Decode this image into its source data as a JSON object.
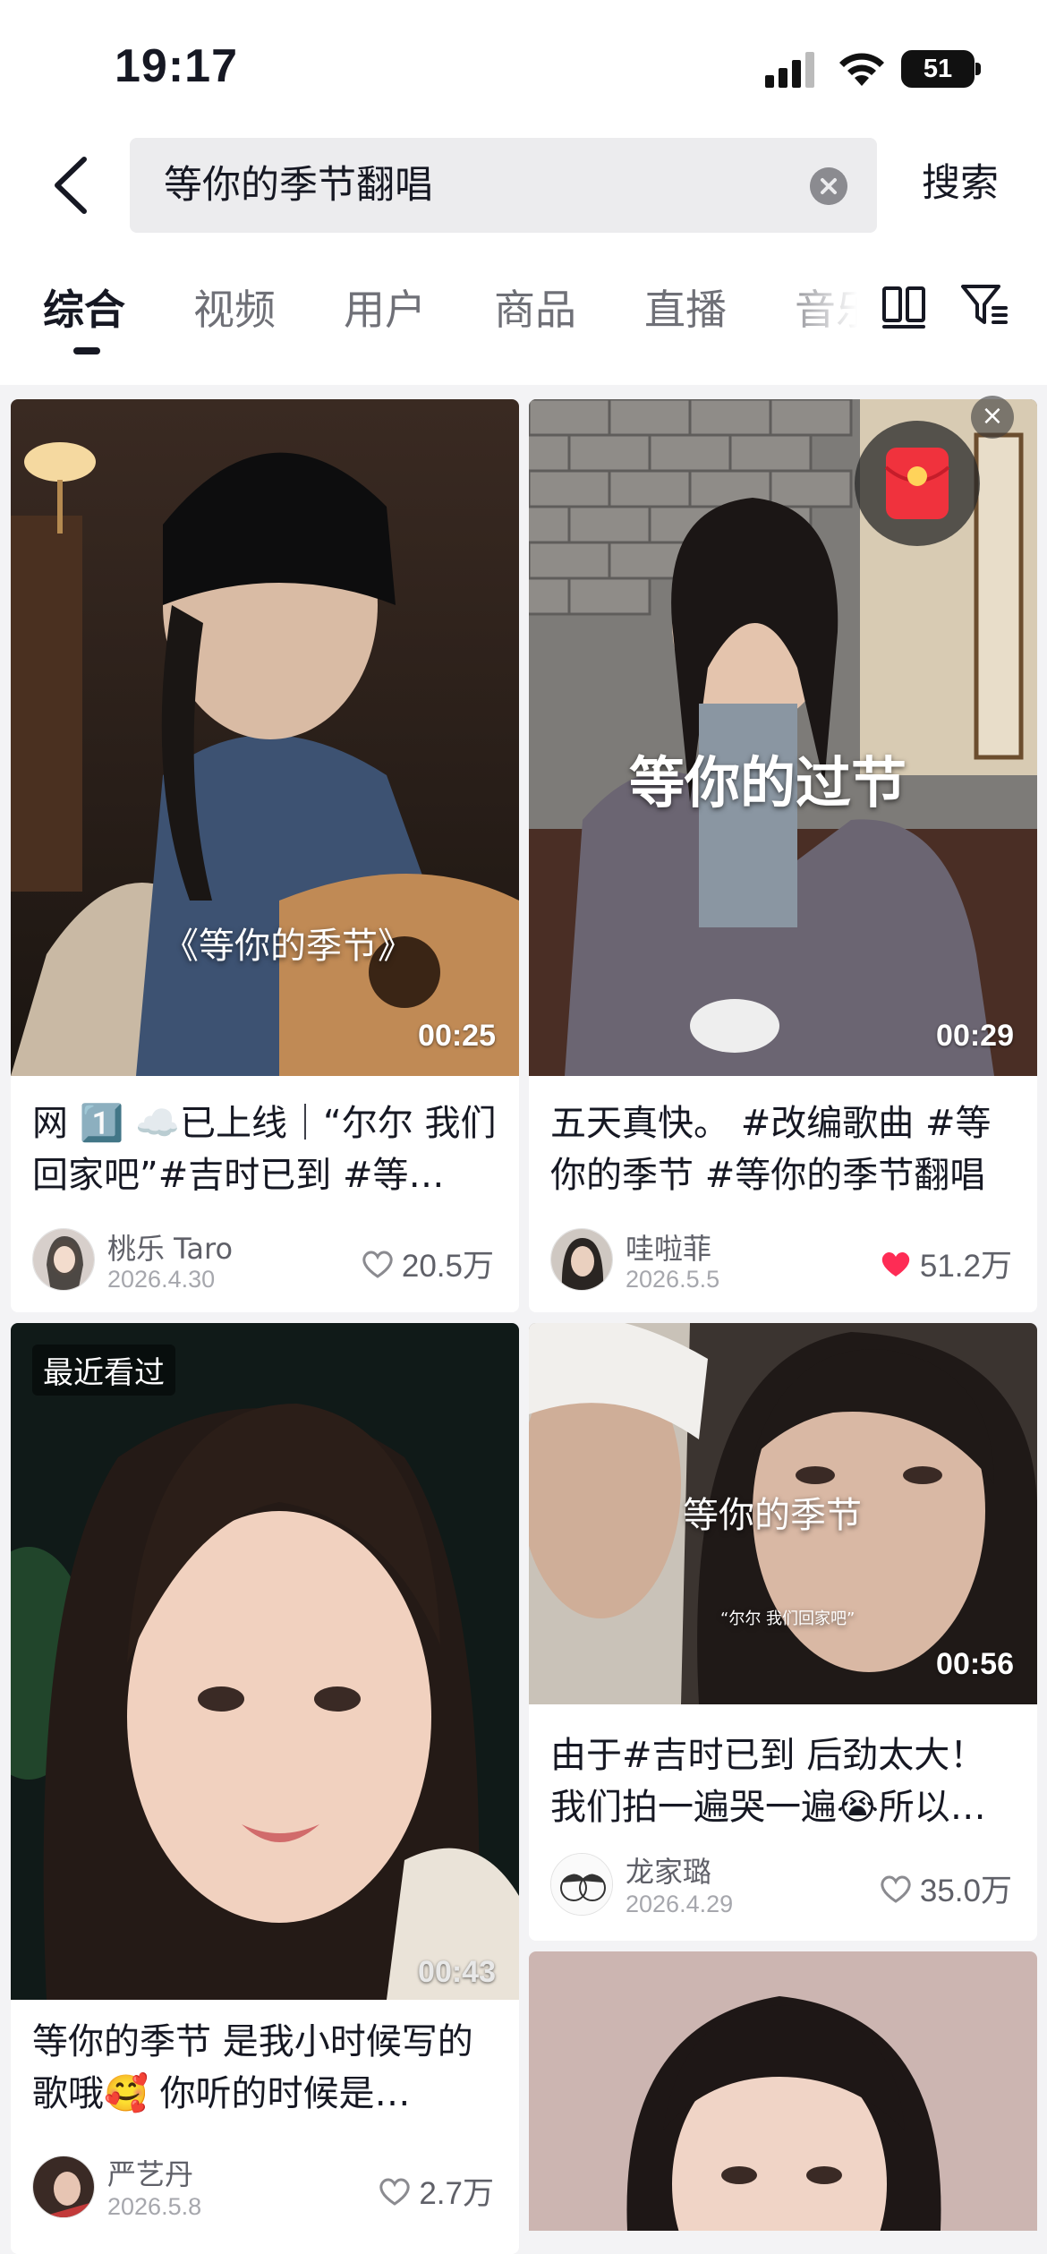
{
  "status_bar": {
    "time": "19:17",
    "battery": "51"
  },
  "search": {
    "query": "等你的季节翻唱",
    "submit_label": "搜索"
  },
  "tabs": [
    {
      "label": "综合"
    },
    {
      "label": "视频"
    },
    {
      "label": "用户"
    },
    {
      "label": "商品"
    },
    {
      "label": "直播"
    },
    {
      "label": "音乐"
    }
  ],
  "cards": [
    {
      "overlay": "《等你的季节》",
      "duration": "00:25",
      "title": "网 1️⃣ ☁️已上线｜“尔尔 我们回家吧”#吉时已到 #等…",
      "author": "桃乐 Taro",
      "date": "2026.4.30",
      "likes": "20.5万",
      "liked": false
    },
    {
      "overlay": "等你的过节",
      "duration": "00:29",
      "title": "五天真快。 #改编歌曲 #等你的季节 #等你的季节翻唱",
      "author": "哇啦菲",
      "date": "2026.5.5",
      "likes": "51.2万",
      "liked": true
    },
    {
      "badge": "最近看过",
      "duration": "00:43",
      "title": "等你的季节 是我小时候写的歌哦🥰 你听的时候是…",
      "author": "严艺丹",
      "date": "2026.5.8",
      "likes": "2.7万",
      "liked": false
    },
    {
      "overlay": "等你的季节",
      "overlay_sub": "“尔尔 我们回家吧”",
      "duration": "00:56",
      "title": "由于#吉时已到 后劲太大！我们拍一遍哭一遍😭所以…",
      "author": "龙家璐",
      "date": "2026.4.29",
      "likes": "35.0万",
      "liked": false
    }
  ],
  "colors": {
    "accent_like": "#fe2c55",
    "text_primary": "#161823",
    "text_secondary": "#5f6068"
  }
}
